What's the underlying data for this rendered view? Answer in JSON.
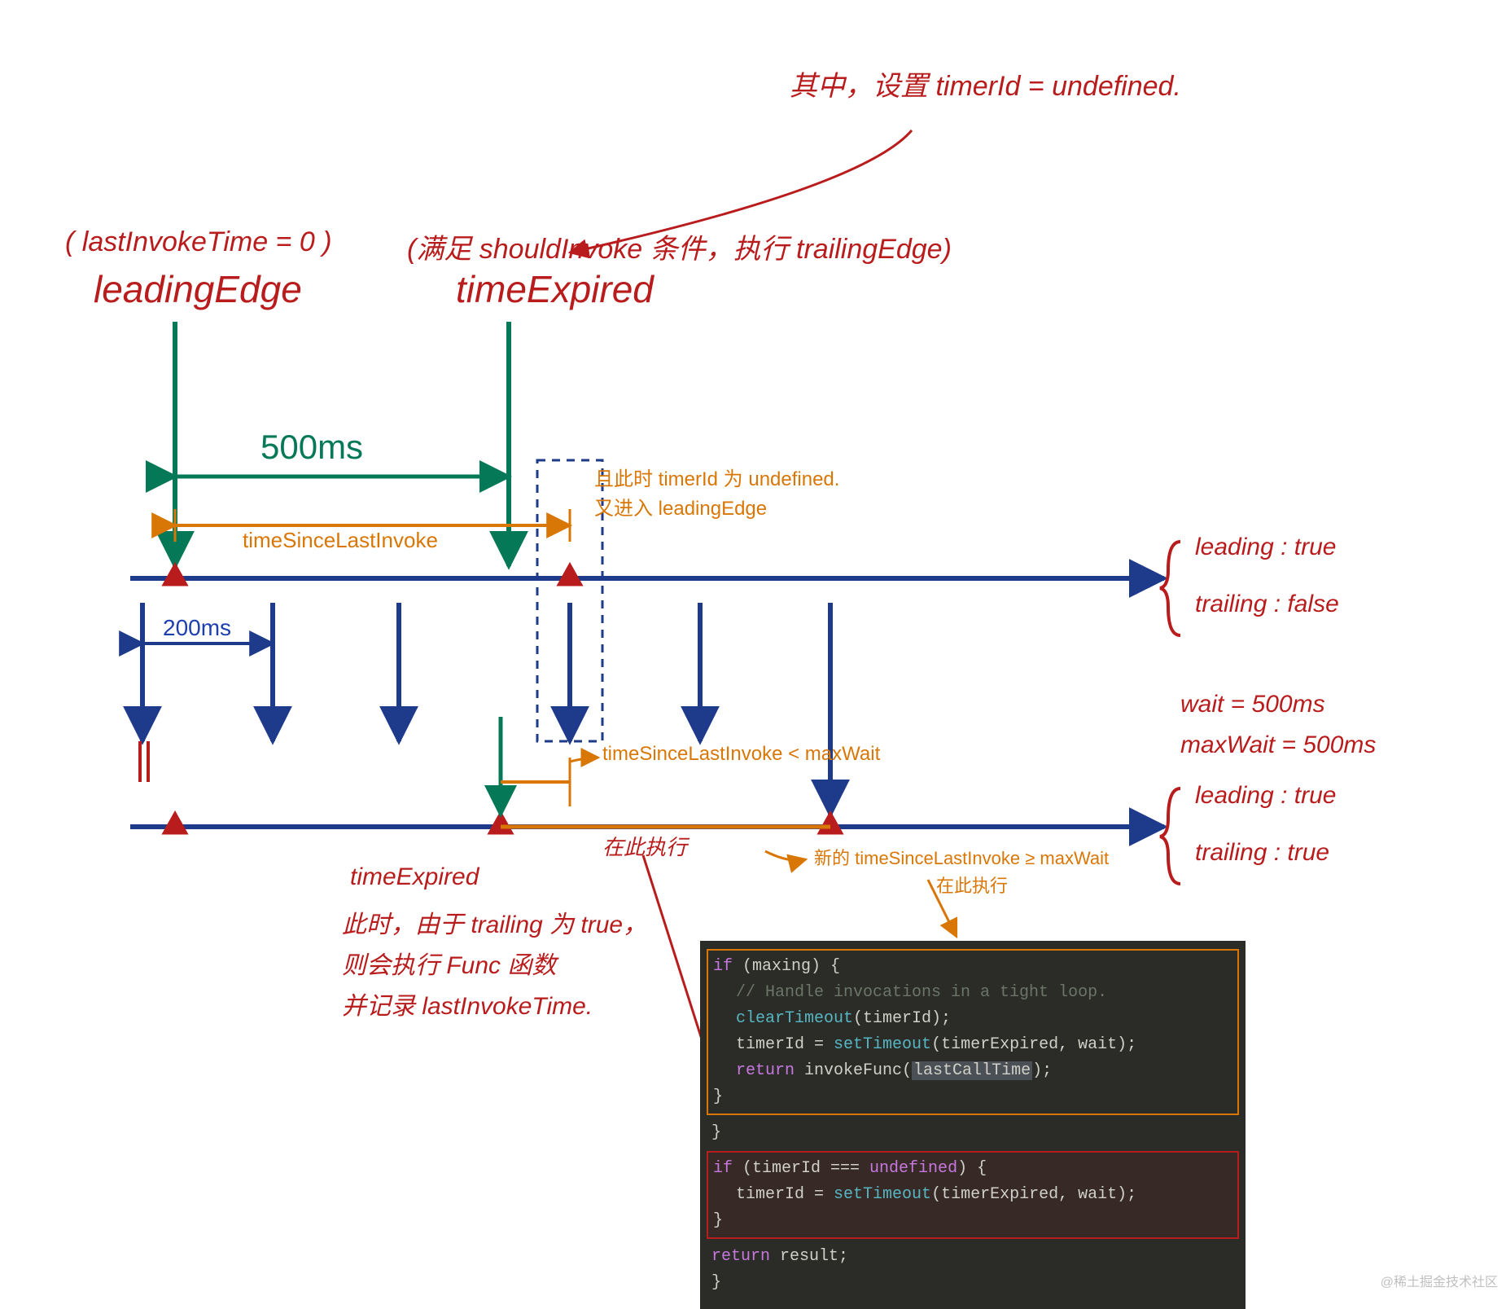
{
  "notes": {
    "top_right_1": "其中，设置 timerId = undefined.",
    "top_left_paren": "( lastInvokeTime = 0 )",
    "top_left_label": "leadingEdge",
    "top_mid_paren": "(满足 shouldInvoke 条件，执行 trailingEdge)",
    "top_mid_label": "timeExpired",
    "span_500ms": "500ms",
    "span_200ms": "200ms",
    "tsli_label": "timeSinceLastInvoke",
    "orange_top_note1": "且此时 timerId 为 undefined.",
    "orange_top_note2": "又进入 leadingEdge",
    "opts_top_leading": "leading : true",
    "opts_top_trailing": "trailing : false",
    "wait_label": "wait = 500ms",
    "maxwait_label": "maxWait = 500ms",
    "opts_bot_leading": "leading : true",
    "opts_bot_trailing": "trailing : true",
    "orange_mid_note": "timeSinceLastInvoke < maxWait",
    "orange_bot_note1": "新的 timeSinceLastInvoke ≥ maxWait",
    "orange_bot_note2": "在此执行",
    "red_mid_exec": "在此执行",
    "red_block_l1": "timeExpired",
    "red_block_l2": "此时，由于 trailing 为 true，",
    "red_block_l3": "则会执行 Func 函数",
    "red_block_l4": "并记录 lastInvokeTime."
  },
  "code": {
    "l1a": "if",
    "l1b": " (maxing) {",
    "l2": "// Handle invocations in a tight loop.",
    "l3a": "clearTimeout",
    "l3b": "(timerId);",
    "l4a": "timerId = ",
    "l4b": "setTimeout",
    "l4c": "(timerExpired, wait);",
    "l5a": "return",
    "l5b": " invokeFunc(",
    "l5c": "lastCallTime",
    "l5d": ");",
    "l6": "}",
    "l7": "}",
    "l8a": "if",
    "l8b": " (timerId === ",
    "l8c": "undefined",
    "l8d": ") {",
    "l9a": "timerId = ",
    "l9b": "setTimeout",
    "l9c": "(timerExpired, wait);",
    "l10": "}",
    "l11a": "return",
    "l11b": " result;",
    "l12": "}"
  },
  "watermark": "@稀土掘金技术社区"
}
